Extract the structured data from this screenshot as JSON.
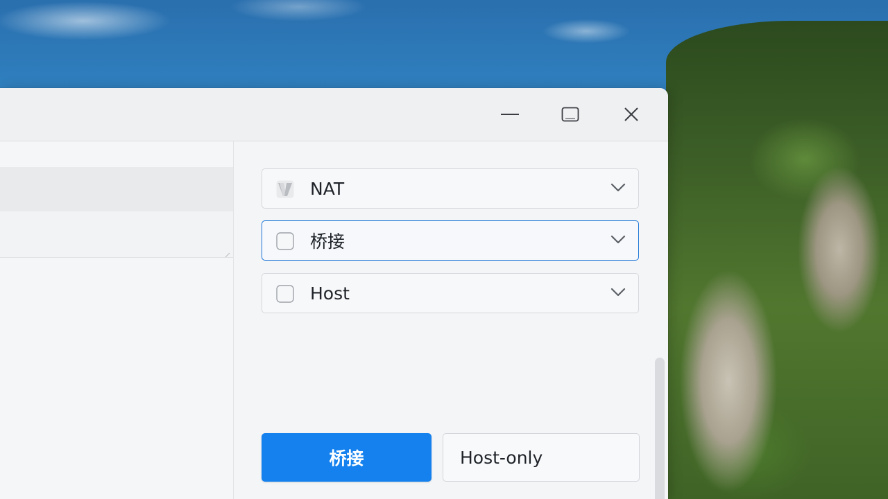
{
  "window": {
    "controls": {
      "minimize_icon": "minimize-icon",
      "maximize_icon": "maximize-icon",
      "close_icon": "close-icon"
    }
  },
  "network_modes": [
    {
      "label": "NAT",
      "checked": true,
      "icon": "vmware-check-icon"
    },
    {
      "label": "桥接",
      "checked": false,
      "focused": true
    },
    {
      "label": "Host",
      "checked": false
    }
  ],
  "buttons": {
    "primary_label": "桥接",
    "secondary_label": "Host-only"
  },
  "colors": {
    "accent": "#1481ee",
    "focus_border": "#1a73d6"
  }
}
